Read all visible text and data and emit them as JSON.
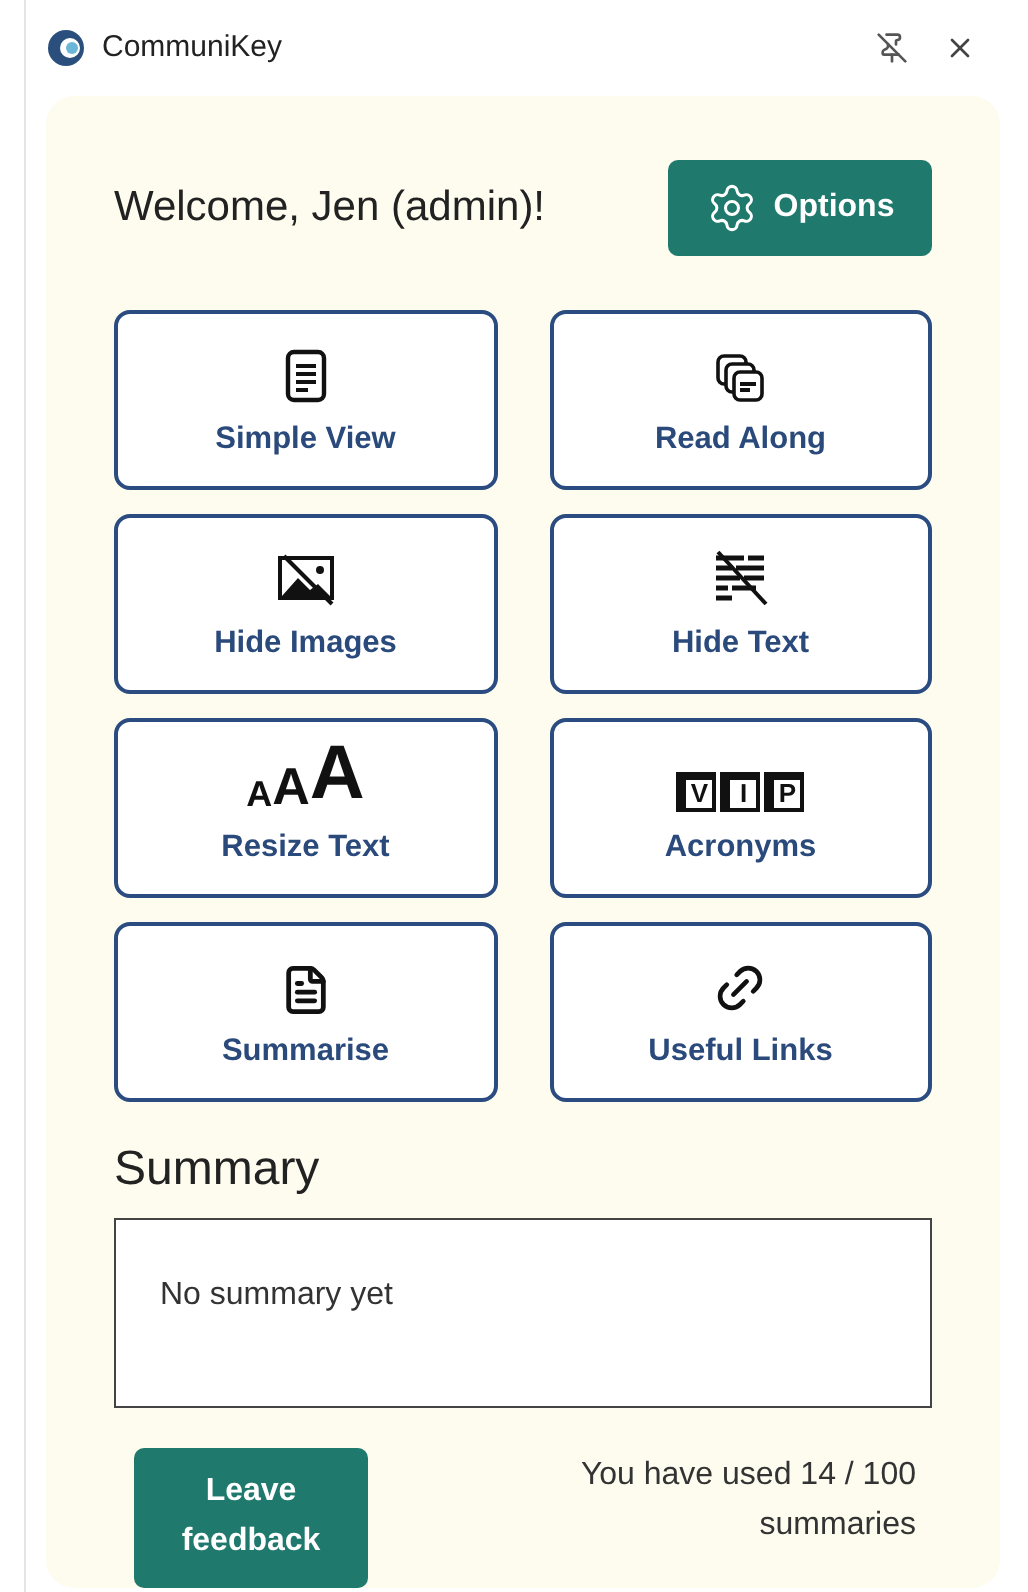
{
  "window": {
    "title": "CommuniKey"
  },
  "header": {
    "welcome": "Welcome, Jen (admin)!",
    "options_button": "Options"
  },
  "tools": [
    {
      "label": "Simple View",
      "kind": "document"
    },
    {
      "label": "Read Along",
      "kind": "stack"
    },
    {
      "label": "Hide Images",
      "kind": "no-image"
    },
    {
      "label": "Hide Text",
      "kind": "no-text"
    },
    {
      "label": "Resize Text",
      "kind": "sizes",
      "icon_letters": [
        "A",
        "A",
        "A"
      ]
    },
    {
      "label": "Acronyms",
      "kind": "blocks",
      "icon_letters": [
        "V",
        "I",
        "P"
      ]
    },
    {
      "label": "Summarise",
      "kind": "summary"
    },
    {
      "label": "Useful Links",
      "kind": "link"
    }
  ],
  "summary": {
    "heading": "Summary",
    "placeholder": "No summary yet"
  },
  "footer": {
    "feedback_button": "Leave feedback",
    "usage": "You have used 14 / 100 summaries"
  }
}
